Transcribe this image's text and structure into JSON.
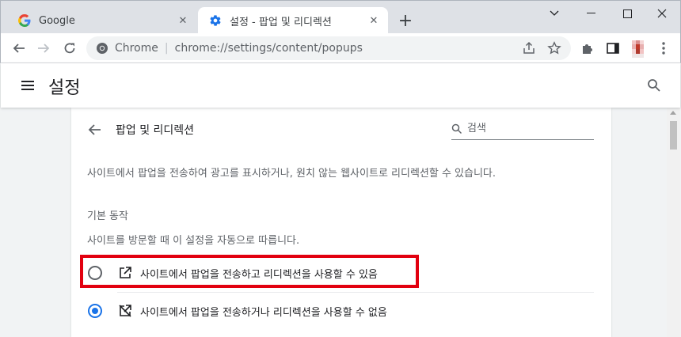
{
  "browser": {
    "tabs": [
      {
        "title": "Google",
        "favicon": "google-g-icon"
      },
      {
        "title": "설정 - 팝업 및 리디렉션",
        "favicon": "gear-icon"
      }
    ],
    "new_tab_label": "+",
    "omnibox": {
      "origin": "Chrome",
      "separator": "|",
      "url": "chrome://settings/content/popups"
    }
  },
  "settings": {
    "title": "설정",
    "page_heading": "팝업 및 리디렉션",
    "search_placeholder": "검색",
    "description": "사이트에서 팝업을 전송하여 광고를 표시하거나, 원치 않는 웹사이트로 리디렉션할 수 있습니다.",
    "section_label": "기본 동작",
    "section_sub": "사이트를 방문할 때 이 설정을 자동으로 따릅니다.",
    "options": [
      {
        "label": "사이트에서 팝업을 전송하고 리디렉션을 사용할 수 있음",
        "icon": "open-in-new-icon",
        "checked": false
      },
      {
        "label": "사이트에서 팝업을 전송하거나 리디렉션을 사용할 수 없음",
        "icon": "popup-blocked-icon",
        "checked": true
      }
    ]
  },
  "colors": {
    "accent": "#1a73e8",
    "highlight": "#e2000f"
  }
}
